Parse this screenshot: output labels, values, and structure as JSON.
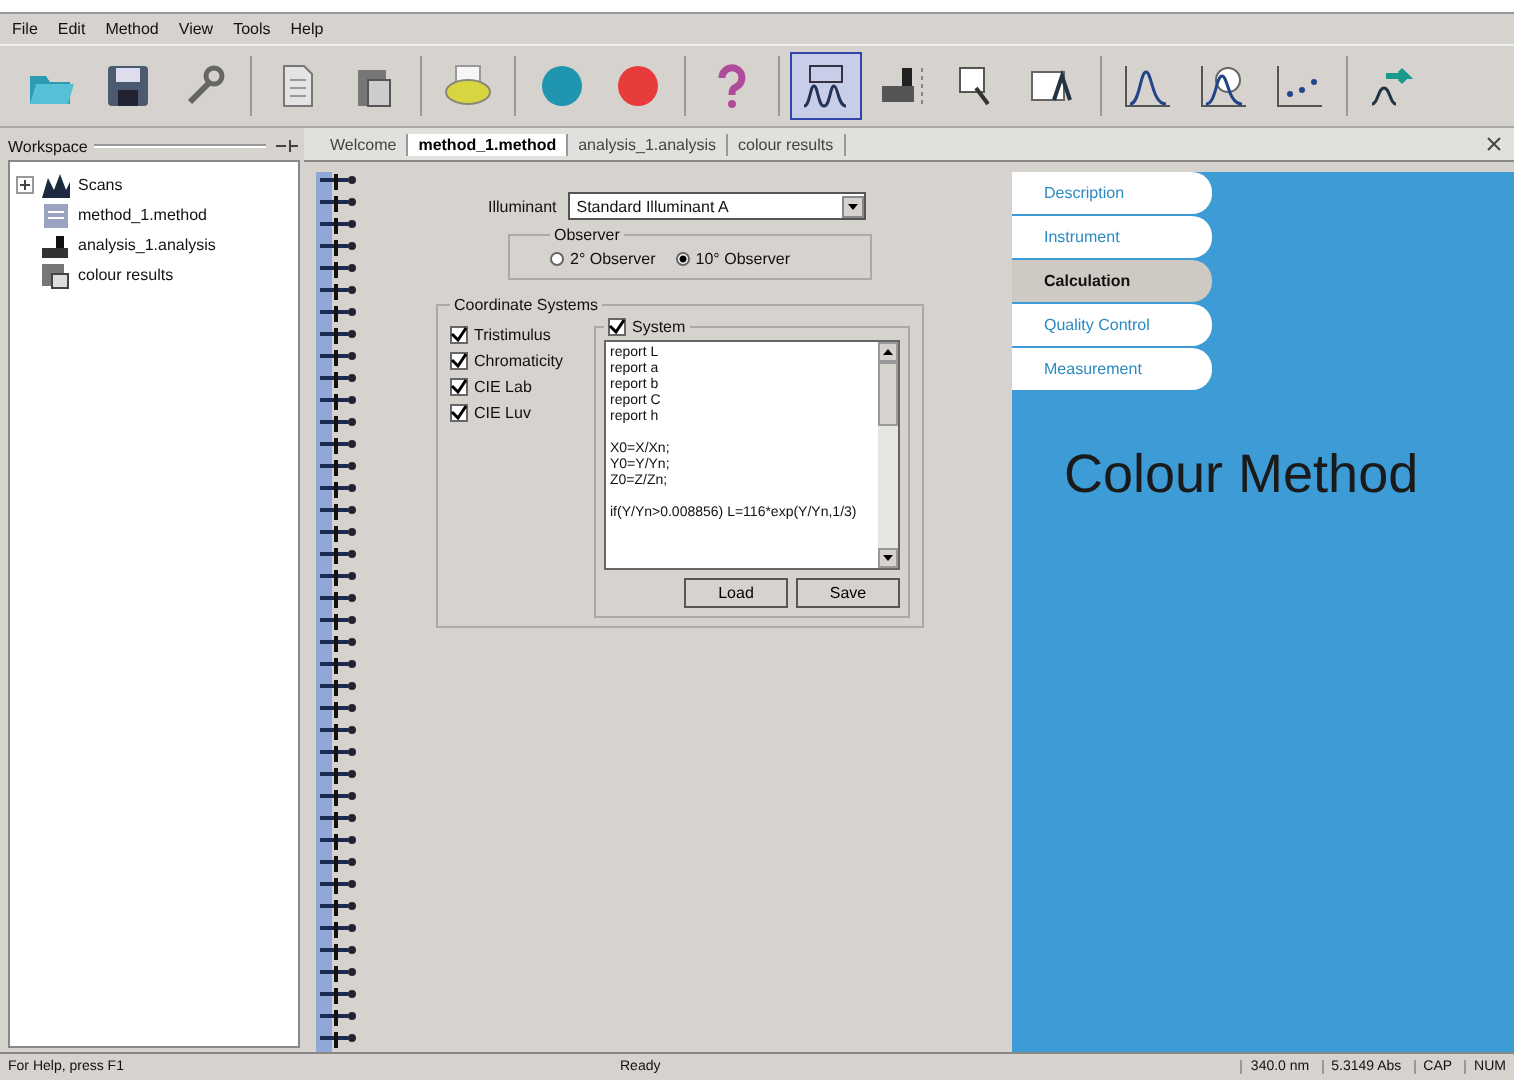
{
  "menu": [
    "File",
    "Edit",
    "Method",
    "View",
    "Tools",
    "Help"
  ],
  "toolbar": [
    {
      "kind": "open",
      "selected": false
    },
    {
      "kind": "save",
      "selected": false
    },
    {
      "kind": "wrench",
      "selected": false
    },
    {
      "kind": "copy",
      "selected": false
    },
    {
      "kind": "paste",
      "selected": false
    },
    {
      "kind": "print",
      "selected": false
    },
    {
      "kind": "teal",
      "selected": false
    },
    {
      "kind": "red",
      "selected": false
    },
    {
      "kind": "help",
      "selected": false
    },
    {
      "kind": "peaks",
      "selected": true
    },
    {
      "kind": "instrument",
      "selected": false
    },
    {
      "kind": "zoom",
      "selected": false
    },
    {
      "kind": "window",
      "selected": false
    },
    {
      "kind": "peak",
      "selected": false
    },
    {
      "kind": "clock",
      "selected": false
    },
    {
      "kind": "points",
      "selected": false
    },
    {
      "kind": "flow",
      "selected": false
    }
  ],
  "workspace": {
    "title": "Workspace",
    "items": [
      {
        "label": "Scans",
        "kind": "folder"
      },
      {
        "label": "method_1.method",
        "kind": "method"
      },
      {
        "label": "analysis_1.analysis",
        "kind": "analysis"
      },
      {
        "label": "colour results",
        "kind": "results"
      }
    ]
  },
  "tabs": [
    {
      "label": "Welcome",
      "selected": false
    },
    {
      "label": "method_1.method",
      "selected": true
    },
    {
      "label": "analysis_1.analysis",
      "selected": false
    },
    {
      "label": "colour results",
      "selected": false
    }
  ],
  "form": {
    "illuminant_label": "Illuminant",
    "illuminant": "Standard Illuminant A",
    "observer": {
      "title": "Observer",
      "options": [
        {
          "label": "2° Observer",
          "selected": false
        },
        {
          "label": "10° Observer",
          "selected": true
        }
      ]
    },
    "coordinates": {
      "title": "Coordinate Systems",
      "options": [
        {
          "label": "Tristimulus",
          "checked": true
        },
        {
          "label": "Chromaticity",
          "checked": true
        },
        {
          "label": "CIE Lab",
          "checked": true
        },
        {
          "label": "CIE Luv",
          "checked": true
        }
      ]
    },
    "system": {
      "label": "System",
      "checked": true,
      "blocks": [
        [
          "report L",
          "report a",
          "report b",
          "report C",
          "report h"
        ],
        [
          "X0=X/Xn;",
          "Y0=Y/Yn;",
          "Z0=Z/Zn;"
        ],
        [
          "if(Y/Yn>0.008856) L=116*exp(Y/Yn,1/3)"
        ]
      ]
    },
    "buttons": [
      "Load",
      "Save"
    ]
  },
  "side_tabs": [
    {
      "label": "Description",
      "selected": false
    },
    {
      "label": "Instrument",
      "selected": false
    },
    {
      "label": "Calculation",
      "selected": true
    },
    {
      "label": "Quality Control",
      "selected": false
    },
    {
      "label": "Measurement",
      "selected": false
    }
  ],
  "panel_title": "Colour Method",
  "status_bar": {
    "message": "For Help, press F1",
    "state": "Ready",
    "wavelength": "340.0 nm",
    "absorbance": "5.3149 Abs",
    "indicators": [
      "CAP",
      "NUM"
    ]
  }
}
